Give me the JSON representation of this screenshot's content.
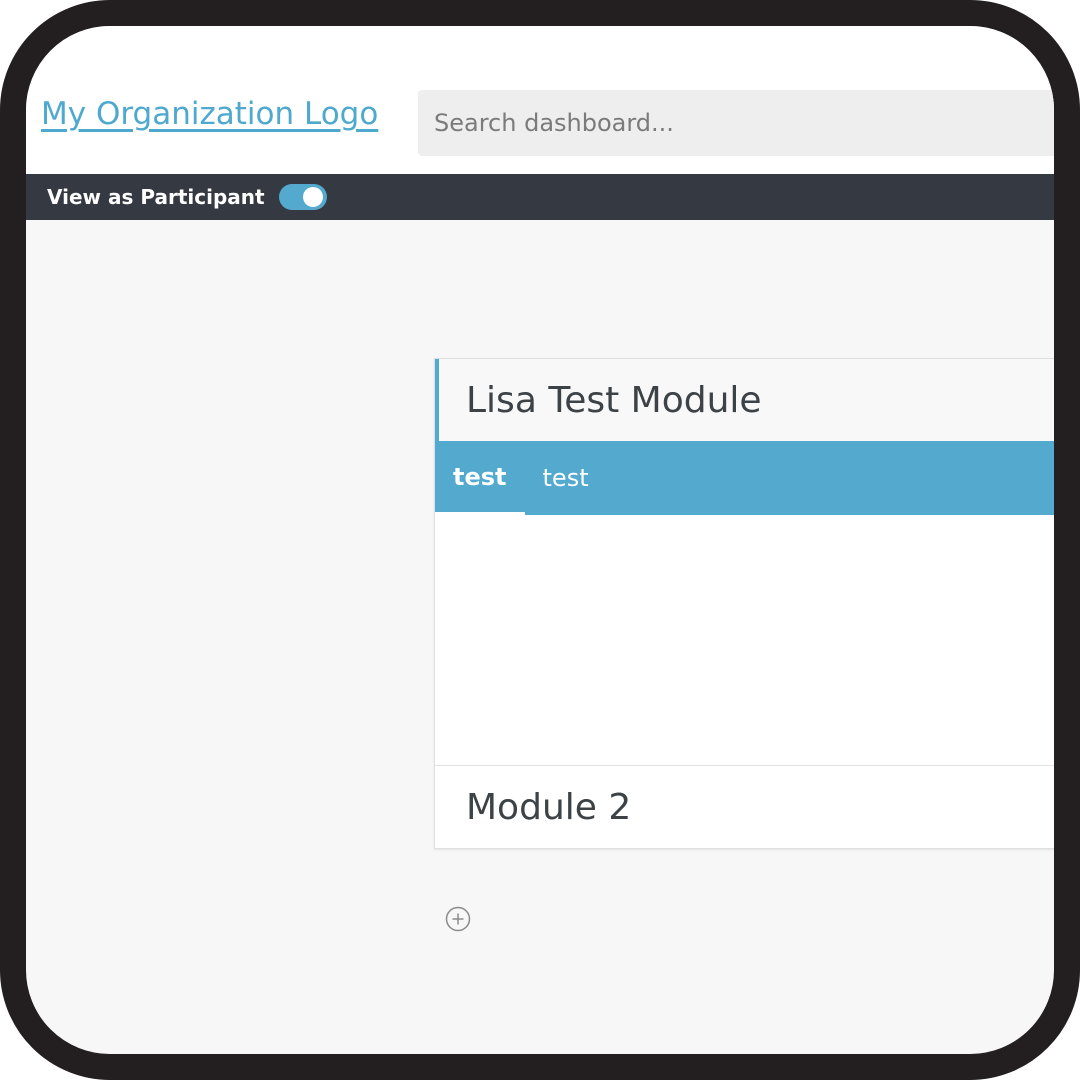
{
  "header": {
    "logo_text": "My Organization Logo",
    "search_placeholder": "Search dashboard..."
  },
  "admin_bar": {
    "view_as_label": "View as Participant",
    "toggle_on": true
  },
  "modules": [
    {
      "title": "Lisa Test Module",
      "tabs": [
        {
          "label": "test",
          "active": true
        },
        {
          "label": "test",
          "active": false
        }
      ]
    },
    {
      "title": "Module 2"
    }
  ],
  "icons": {
    "add": "plus-circle-icon"
  },
  "colors": {
    "accent": "#54a9cf",
    "admin_bar": "#353a42",
    "frame": "#231f20"
  }
}
